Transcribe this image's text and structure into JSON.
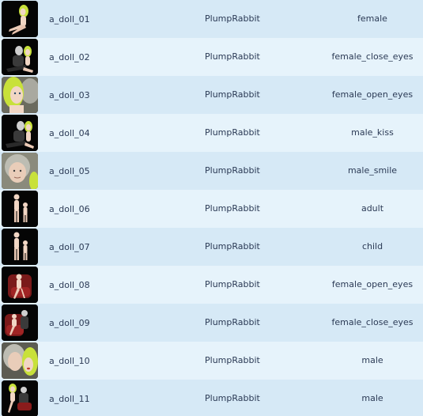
{
  "rows": [
    {
      "name": "a_doll_01",
      "author": "PlumpRabbit",
      "tag": "female",
      "thumb": "figure-sitting-icon"
    },
    {
      "name": "a_doll_02",
      "author": "PlumpRabbit",
      "tag": "female_close_eyes",
      "thumb": "figures-embrace-icon"
    },
    {
      "name": "a_doll_03",
      "author": "PlumpRabbit",
      "tag": "female_open_eyes",
      "thumb": "face-closeup-icon"
    },
    {
      "name": "a_doll_04",
      "author": "PlumpRabbit",
      "tag": "male_kiss",
      "thumb": "figures-embrace-icon"
    },
    {
      "name": "a_doll_05",
      "author": "PlumpRabbit",
      "tag": "male_smile",
      "thumb": "face-closeup-icon"
    },
    {
      "name": "a_doll_06",
      "author": "PlumpRabbit",
      "tag": "adult",
      "thumb": "figures-standing-icon"
    },
    {
      "name": "a_doll_07",
      "author": "PlumpRabbit",
      "tag": "child",
      "thumb": "figures-standing-icon"
    },
    {
      "name": "a_doll_08",
      "author": "PlumpRabbit",
      "tag": "female_open_eyes",
      "thumb": "figure-chair-icon"
    },
    {
      "name": "a_doll_09",
      "author": "PlumpRabbit",
      "tag": "female_close_eyes",
      "thumb": "figure-chair-icon"
    },
    {
      "name": "a_doll_10",
      "author": "PlumpRabbit",
      "tag": "male",
      "thumb": "face-closeup-icon"
    },
    {
      "name": "a_doll_11",
      "author": "PlumpRabbit",
      "tag": "male",
      "thumb": "figures-embrace-icon"
    }
  ],
  "colors": {
    "row_odd": "#d6e9f6",
    "row_even": "#e6f3fb",
    "text": "#2b3a55"
  }
}
